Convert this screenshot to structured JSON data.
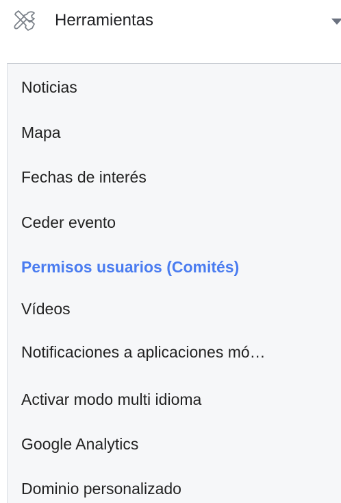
{
  "header": {
    "title": "Herramientas",
    "icon": "tools-icon",
    "expand_icon": "caret-down-icon"
  },
  "menu": {
    "items": [
      {
        "label": "Noticias",
        "active": false
      },
      {
        "label": "Mapa",
        "active": false
      },
      {
        "label": "Fechas de interés",
        "active": false
      },
      {
        "label": "Ceder evento",
        "active": false
      },
      {
        "label": "Permisos usuarios (Comités)",
        "active": true
      },
      {
        "label": "Vídeos",
        "active": false
      },
      {
        "label": "Notificaciones a aplicaciones mó…",
        "active": false
      },
      {
        "label": "Activar modo multi idioma",
        "active": false
      },
      {
        "label": "Google Analytics",
        "active": false
      },
      {
        "label": "Dominio personalizado",
        "active": false
      }
    ]
  },
  "colors": {
    "active_item": "#4a7cf0",
    "text": "#222222",
    "panel_background": "#f6f7f9"
  }
}
